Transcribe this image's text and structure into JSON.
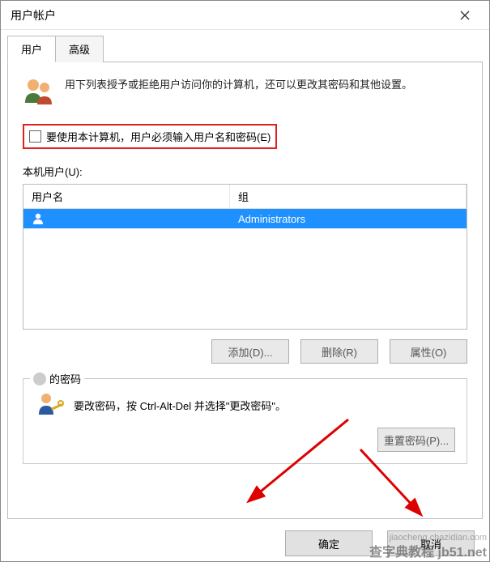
{
  "window": {
    "title": "用户帐户"
  },
  "tabs": {
    "user": "用户",
    "advanced": "高级"
  },
  "intro": "用下列表授予或拒绝用户访问你的计算机，还可以更改其密码和其他设置。",
  "checkbox": {
    "label": "要使用本计算机，用户必须输入用户名和密码(E)"
  },
  "listLabel": "本机用户(U):",
  "columns": {
    "name": "用户名",
    "group": "组"
  },
  "rows": [
    {
      "name": "",
      "group": "Administrators",
      "selected": true
    }
  ],
  "buttons": {
    "add": "添加(D)...",
    "remove": "删除(R)",
    "props": "属性(O)",
    "resetPw": "重置密码(P)...",
    "ok": "确定",
    "cancel": "取消"
  },
  "pwBox": {
    "legend": "的密码",
    "text": "要改密码，按 Ctrl-Alt-Del 并选择\"更改密码\"。"
  },
  "watermark": {
    "main": "查字典教程 jb51.net",
    "sub": "jiaocheng.chazidian.com"
  }
}
